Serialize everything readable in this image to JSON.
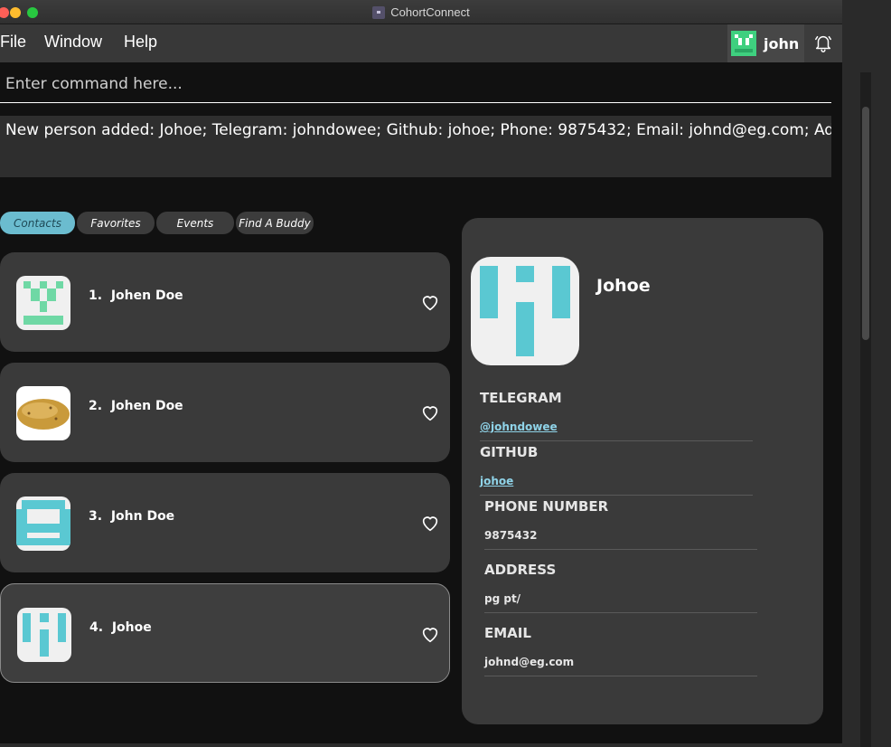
{
  "window": {
    "title": "CohortConnect"
  },
  "menu": {
    "file": "File",
    "window": "Window",
    "help": "Help"
  },
  "user": {
    "name": "john"
  },
  "command": {
    "placeholder": "Enter command here..."
  },
  "result": {
    "text": "New person added: Johoe; Telegram: johndowee; Github: johoe; Phone: 9875432; Email: johnd@eg.com; Address: pg pt/"
  },
  "tabs": [
    {
      "label": "Contacts",
      "active": true
    },
    {
      "label": "Favorites",
      "active": false
    },
    {
      "label": "Events",
      "active": false
    },
    {
      "label": "Find A Buddy",
      "active": false
    }
  ],
  "contacts": [
    {
      "index": "1.",
      "name": "Johen Doe",
      "avatar": "green-pixel-avatar"
    },
    {
      "index": "2.",
      "name": "Johen Doe",
      "avatar": "potato-image"
    },
    {
      "index": "3.",
      "name": "John Doe",
      "avatar": "cyan-pixel-avatar"
    },
    {
      "index": "4.",
      "name": "Johoe",
      "avatar": "cyan-pixel-avatar",
      "selected": true
    }
  ],
  "detail": {
    "name": "Johoe",
    "telegram_label": "TELEGRAM",
    "telegram": "@johndowee",
    "github_label": "GITHUB",
    "github": "johoe",
    "phone_label": "PHONE NUMBER",
    "phone": "9875432",
    "address_label": "ADDRESS",
    "address": "pg pt/",
    "email_label": "EMAIL",
    "email": "johnd@eg.com"
  },
  "colors": {
    "accent": "#6bbccf",
    "avatar_cyan": "#5ac8d2",
    "avatar_green": "#6fd8a5",
    "link": "#8fd3e8"
  },
  "icons": {
    "bell": "bell-icon",
    "heart": "heart-outline-icon"
  }
}
